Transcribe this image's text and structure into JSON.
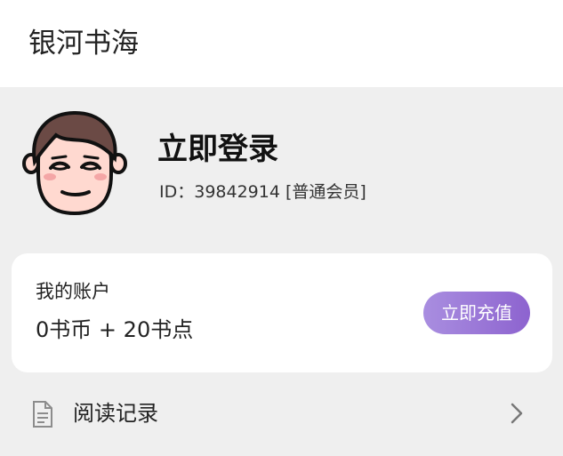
{
  "header": {
    "app_title": "银河书海"
  },
  "profile": {
    "avatar_icon": "cartoon-face-avatar",
    "login_label": "立即登录",
    "id_prefix": "ID：",
    "user_id": "39842914",
    "member_level": "[普通会员]"
  },
  "account": {
    "label": "我的账户",
    "coins": "0书币",
    "separator": "+",
    "points": "20书点",
    "recharge_button": "立即充值",
    "button_gradient_start": "#a98ee0",
    "button_gradient_end": "#8d63cf"
  },
  "menu": {
    "items": [
      {
        "label": "阅读记录",
        "icon": "document-icon",
        "trailing_icon": "chevron-right-icon"
      }
    ]
  },
  "colors": {
    "page_background": "#efefef",
    "card_background": "#ffffff",
    "text_primary": "#222222"
  }
}
